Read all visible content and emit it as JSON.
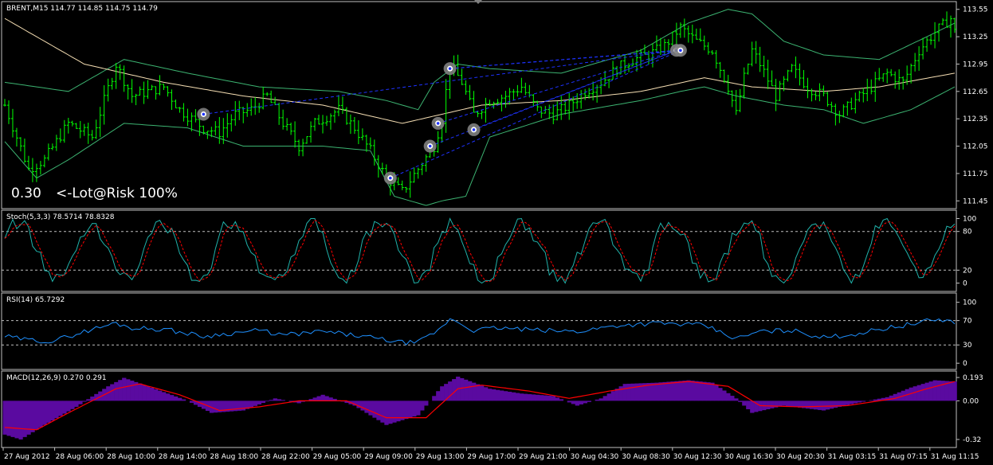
{
  "chart_data": [
    {
      "type": "line",
      "panel": "price",
      "header": "BRENT,M15  114.77 114.85 114.75 114.79",
      "note_value": "0.30",
      "note_text": "<-Lot@Risk 100%",
      "ylim": [
        111.4,
        113.6
      ],
      "y_ticks": [
        {
          "v": 113.55,
          "label": "113.55"
        },
        {
          "v": 113.25,
          "label": "113.25"
        },
        {
          "v": 112.95,
          "label": "112.95"
        },
        {
          "v": 112.65,
          "label": "112.65"
        },
        {
          "v": 112.35,
          "label": "112.35"
        },
        {
          "v": 112.05,
          "label": "112.05"
        },
        {
          "v": 111.75,
          "label": "111.75"
        },
        {
          "v": 111.45,
          "label": "111.45"
        }
      ],
      "x_labels": [
        "27 Aug 2012",
        "28 Aug 06:00",
        "28 Aug 10:00",
        "28 Aug 14:00",
        "28 Aug 18:00",
        "28 Aug 22:00",
        "29 Aug 05:00",
        "29 Aug 09:00",
        "29 Aug 13:00",
        "29 Aug 17:00",
        "29 Aug 21:00",
        "30 Aug 04:30",
        "30 Aug 08:30",
        "30 Aug 12:30",
        "30 Aug 16:30",
        "30 Aug 20:30",
        "31 Aug 03:15",
        "31 Aug 07:15",
        "31 Aug 11:15"
      ],
      "x_count": 240,
      "price_knots": [
        [
          0,
          112.5
        ],
        [
          6,
          111.8
        ],
        [
          10,
          111.9
        ],
        [
          16,
          112.3
        ],
        [
          22,
          112.15
        ],
        [
          28,
          112.95
        ],
        [
          32,
          112.6
        ],
        [
          40,
          112.7
        ],
        [
          44,
          112.45
        ],
        [
          50,
          112.25
        ],
        [
          54,
          112.2
        ],
        [
          58,
          112.4
        ],
        [
          62,
          112.45
        ],
        [
          66,
          112.6
        ],
        [
          70,
          112.3
        ],
        [
          74,
          112.05
        ],
        [
          78,
          112.3
        ],
        [
          84,
          112.45
        ],
        [
          88,
          112.25
        ],
        [
          92,
          112.0
        ],
        [
          96,
          111.7
        ],
        [
          100,
          111.55
        ],
        [
          104,
          111.8
        ],
        [
          108,
          112.05
        ],
        [
          110,
          112.35
        ],
        [
          112,
          112.95
        ],
        [
          115,
          112.75
        ],
        [
          118,
          112.4
        ],
        [
          122,
          112.55
        ],
        [
          126,
          112.6
        ],
        [
          130,
          112.7
        ],
        [
          134,
          112.45
        ],
        [
          138,
          112.4
        ],
        [
          142,
          112.5
        ],
        [
          146,
          112.65
        ],
        [
          150,
          112.75
        ],
        [
          154,
          112.9
        ],
        [
          158,
          113.0
        ],
        [
          162,
          113.05
        ],
        [
          166,
          113.15
        ],
        [
          170,
          113.35
        ],
        [
          174,
          113.2
        ],
        [
          178,
          113.1
        ],
        [
          182,
          112.7
        ],
        [
          184,
          112.4
        ],
        [
          186,
          112.8
        ],
        [
          188,
          113.1
        ],
        [
          190,
          112.95
        ],
        [
          194,
          112.6
        ],
        [
          198,
          112.9
        ],
        [
          202,
          112.7
        ],
        [
          206,
          112.6
        ],
        [
          210,
          112.4
        ],
        [
          214,
          112.55
        ],
        [
          218,
          112.7
        ],
        [
          222,
          112.85
        ],
        [
          226,
          112.75
        ],
        [
          230,
          113.1
        ],
        [
          234,
          113.3
        ],
        [
          238,
          113.45
        ],
        [
          239,
          113.3
        ]
      ],
      "upper_band_knots": [
        [
          0,
          112.75
        ],
        [
          16,
          112.65
        ],
        [
          30,
          113.0
        ],
        [
          46,
          112.85
        ],
        [
          64,
          112.7
        ],
        [
          84,
          112.65
        ],
        [
          96,
          112.55
        ],
        [
          104,
          112.45
        ],
        [
          108,
          112.75
        ],
        [
          114,
          112.95
        ],
        [
          122,
          112.9
        ],
        [
          140,
          112.85
        ],
        [
          160,
          113.1
        ],
        [
          172,
          113.4
        ],
        [
          182,
          113.55
        ],
        [
          188,
          113.5
        ],
        [
          196,
          113.2
        ],
        [
          206,
          113.05
        ],
        [
          220,
          113.0
        ],
        [
          232,
          113.25
        ],
        [
          239,
          113.4
        ]
      ],
      "lower_band_knots": [
        [
          0,
          112.1
        ],
        [
          8,
          111.7
        ],
        [
          16,
          111.9
        ],
        [
          30,
          112.3
        ],
        [
          46,
          112.25
        ],
        [
          60,
          112.05
        ],
        [
          80,
          112.05
        ],
        [
          92,
          112.0
        ],
        [
          98,
          111.5
        ],
        [
          106,
          111.4
        ],
        [
          110,
          111.45
        ],
        [
          116,
          111.5
        ],
        [
          122,
          112.15
        ],
        [
          140,
          112.4
        ],
        [
          160,
          112.55
        ],
        [
          170,
          112.65
        ],
        [
          176,
          112.7
        ],
        [
          184,
          112.6
        ],
        [
          196,
          112.5
        ],
        [
          206,
          112.45
        ],
        [
          216,
          112.3
        ],
        [
          228,
          112.45
        ],
        [
          239,
          112.7
        ]
      ],
      "ma_knots": [
        [
          0,
          113.45
        ],
        [
          20,
          112.95
        ],
        [
          40,
          112.75
        ],
        [
          60,
          112.6
        ],
        [
          80,
          112.5
        ],
        [
          100,
          112.3
        ],
        [
          120,
          112.5
        ],
        [
          140,
          112.55
        ],
        [
          160,
          112.65
        ],
        [
          176,
          112.8
        ],
        [
          188,
          112.7
        ],
        [
          206,
          112.65
        ],
        [
          220,
          112.7
        ],
        [
          239,
          112.85
        ]
      ],
      "markers": [
        {
          "i": 50,
          "v": 112.4
        },
        {
          "i": 97,
          "v": 111.7
        },
        {
          "i": 107,
          "v": 112.05
        },
        {
          "i": 109,
          "v": 112.3
        },
        {
          "i": 112,
          "v": 112.9
        },
        {
          "i": 118,
          "v": 112.23
        },
        {
          "i": 169,
          "v": 113.1
        },
        {
          "i": 170,
          "v": 113.1
        }
      ],
      "dashed_links": [
        [
          0,
          6
        ],
        [
          1,
          7
        ],
        [
          2,
          6
        ],
        [
          3,
          6
        ],
        [
          4,
          6
        ],
        [
          5,
          6
        ],
        [
          4,
          7
        ]
      ],
      "colors": {
        "bars": "#00ff00",
        "bands": "#3cb371",
        "ma": "#f5deb3",
        "links": "#1e32ff",
        "marker": "#808080"
      }
    },
    {
      "type": "line",
      "panel": "stochastic",
      "header": "Stoch(5,3,3) 78.5714 78.8328",
      "ylim": [
        -8,
        108
      ],
      "y_ticks": [
        {
          "v": 100,
          "label": "100"
        },
        {
          "v": 80,
          "label": "80"
        },
        {
          "v": 20,
          "label": "20"
        },
        {
          "v": 0,
          "label": "0"
        }
      ],
      "levels": [
        80,
        20
      ],
      "colors": {
        "main": "#20b2aa",
        "signal": "#ff0000"
      }
    },
    {
      "type": "line",
      "panel": "rsi",
      "header": "RSI(14) 65.7292",
      "ylim": [
        -5,
        110
      ],
      "y_ticks": [
        {
          "v": 100,
          "label": "100"
        },
        {
          "v": 70,
          "label": "70"
        },
        {
          "v": 30,
          "label": "30"
        },
        {
          "v": 0,
          "label": "0"
        }
      ],
      "levels": [
        70,
        30
      ],
      "knots": [
        [
          0,
          44
        ],
        [
          6,
          38
        ],
        [
          12,
          36
        ],
        [
          20,
          52
        ],
        [
          28,
          66
        ],
        [
          32,
          58
        ],
        [
          40,
          56
        ],
        [
          50,
          44
        ],
        [
          58,
          50
        ],
        [
          64,
          54
        ],
        [
          70,
          46
        ],
        [
          80,
          52
        ],
        [
          90,
          44
        ],
        [
          100,
          34
        ],
        [
          104,
          34
        ],
        [
          110,
          58
        ],
        [
          112,
          74
        ],
        [
          118,
          54
        ],
        [
          124,
          58
        ],
        [
          134,
          54
        ],
        [
          144,
          52
        ],
        [
          154,
          62
        ],
        [
          164,
          66
        ],
        [
          170,
          64
        ],
        [
          176,
          62
        ],
        [
          184,
          40
        ],
        [
          190,
          52
        ],
        [
          198,
          54
        ],
        [
          206,
          42
        ],
        [
          214,
          48
        ],
        [
          222,
          58
        ],
        [
          230,
          66
        ],
        [
          234,
          72
        ],
        [
          239,
          68
        ]
      ],
      "colors": {
        "line": "#1e90ff"
      }
    },
    {
      "type": "bar",
      "panel": "macd",
      "header": "MACD(12,26,9) 0.270 0.291",
      "ylim": [
        -0.36,
        0.22
      ],
      "y_ticks": [
        {
          "v": 0.193,
          "label": "0.193"
        },
        {
          "v": 0.0,
          "label": "0.00"
        },
        {
          "v": -0.32,
          "label": "-0.32"
        }
      ],
      "hist_knots": [
        [
          0,
          -0.28
        ],
        [
          4,
          -0.32
        ],
        [
          10,
          -0.2
        ],
        [
          18,
          -0.05
        ],
        [
          26,
          0.12
        ],
        [
          30,
          0.19
        ],
        [
          36,
          0.12
        ],
        [
          46,
          0.0
        ],
        [
          52,
          -0.1
        ],
        [
          60,
          -0.08
        ],
        [
          68,
          0.02
        ],
        [
          74,
          -0.02
        ],
        [
          80,
          0.05
        ],
        [
          88,
          -0.04
        ],
        [
          96,
          -0.2
        ],
        [
          104,
          -0.12
        ],
        [
          110,
          0.12
        ],
        [
          114,
          0.2
        ],
        [
          122,
          0.1
        ],
        [
          130,
          0.06
        ],
        [
          138,
          0.04
        ],
        [
          144,
          -0.04
        ],
        [
          150,
          0.02
        ],
        [
          156,
          0.14
        ],
        [
          164,
          0.15
        ],
        [
          172,
          0.17
        ],
        [
          178,
          0.15
        ],
        [
          184,
          0.02
        ],
        [
          188,
          -0.1
        ],
        [
          196,
          -0.04
        ],
        [
          206,
          -0.08
        ],
        [
          214,
          -0.02
        ],
        [
          222,
          0.03
        ],
        [
          228,
          0.11
        ],
        [
          234,
          0.17
        ],
        [
          239,
          0.16
        ]
      ],
      "signal_knots": [
        [
          0,
          -0.22
        ],
        [
          8,
          -0.24
        ],
        [
          16,
          -0.1
        ],
        [
          28,
          0.1
        ],
        [
          34,
          0.14
        ],
        [
          44,
          0.05
        ],
        [
          54,
          -0.08
        ],
        [
          64,
          -0.05
        ],
        [
          74,
          0.0
        ],
        [
          86,
          0.0
        ],
        [
          96,
          -0.14
        ],
        [
          106,
          -0.14
        ],
        [
          114,
          0.1
        ],
        [
          120,
          0.13
        ],
        [
          132,
          0.08
        ],
        [
          142,
          0.02
        ],
        [
          152,
          0.08
        ],
        [
          162,
          0.13
        ],
        [
          172,
          0.16
        ],
        [
          182,
          0.12
        ],
        [
          190,
          -0.04
        ],
        [
          200,
          -0.05
        ],
        [
          212,
          -0.04
        ],
        [
          224,
          0.02
        ],
        [
          232,
          0.1
        ],
        [
          239,
          0.16
        ]
      ],
      "colors": {
        "hist": "#5a0aa0",
        "signal": "#ff0000"
      }
    }
  ]
}
